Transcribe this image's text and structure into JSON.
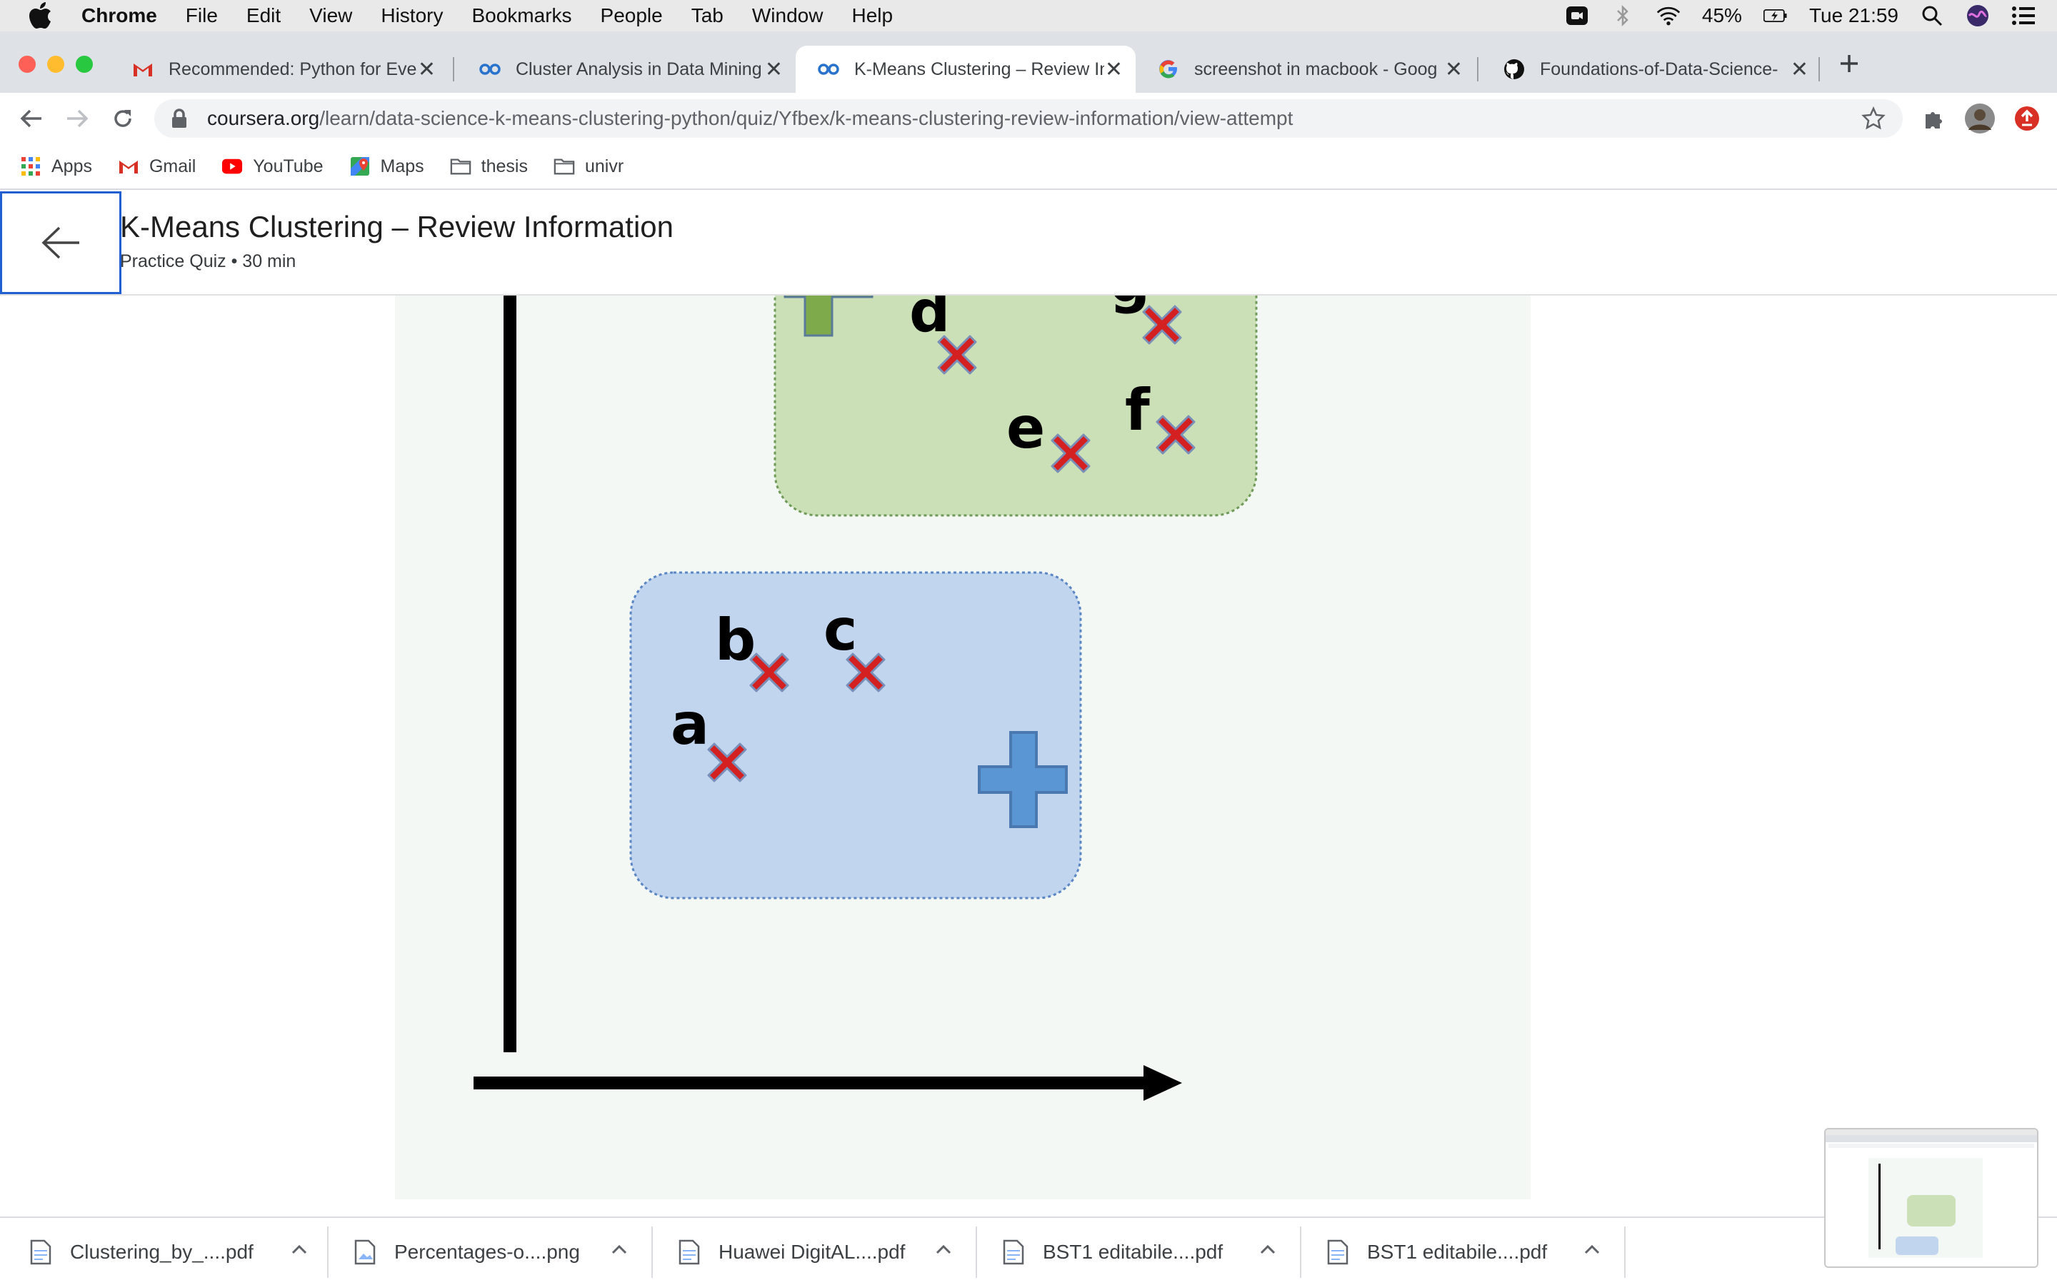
{
  "menubar": {
    "app": "Chrome",
    "items": [
      "File",
      "Edit",
      "View",
      "History",
      "Bookmarks",
      "People",
      "Tab",
      "Window",
      "Help"
    ],
    "battery": "45%",
    "clock": "Tue 21:59"
  },
  "tabs": [
    {
      "title": "Recommended: Python for Eve",
      "icon": "gmail-icon"
    },
    {
      "title": "Cluster Analysis in Data Mining",
      "icon": "coursera-icon"
    },
    {
      "title": "K-Means Clustering – Review In",
      "icon": "coursera-icon"
    },
    {
      "title": "screenshot in macbook - Goog",
      "icon": "google-icon"
    },
    {
      "title": "Foundations-of-Data-Science-",
      "icon": "github-icon"
    }
  ],
  "address": {
    "host": "coursera.org",
    "path": "/learn/data-science-k-means-clustering-python/quiz/Yfbex/k-means-clustering-review-information/view-attempt"
  },
  "bookmarks": [
    "Apps",
    "Gmail",
    "YouTube",
    "Maps",
    "thesis",
    "univr"
  ],
  "page": {
    "title": "K-Means Clustering – Review Information",
    "subtitle": "Practice Quiz • 30 min"
  },
  "figure": {
    "point_labels": [
      "a",
      "b",
      "c",
      "d",
      "e",
      "f",
      "g"
    ],
    "colors": {
      "green_cluster": "#cce0b8",
      "blue_cluster": "#c2d5ee",
      "x_marker": "#d42020",
      "blue_centroid": "#5b96d4",
      "green_centroid": "#7faa4c"
    }
  },
  "downloads": [
    "Clustering_by_....pdf",
    "Percentages-o....png",
    "Huawei DigitAL....pdf",
    "BST1 editabile....pdf",
    "BST1 editabile....pdf"
  ]
}
